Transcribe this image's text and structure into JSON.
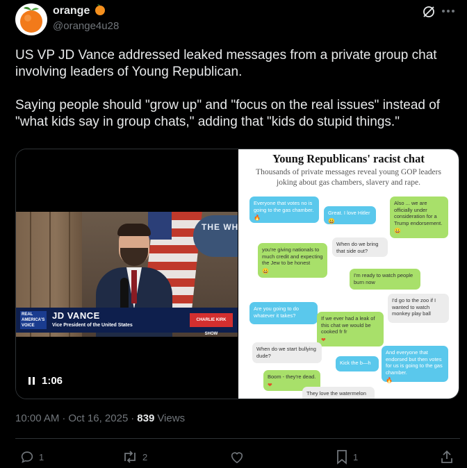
{
  "author": {
    "name": "orange",
    "name_emoji": "🍊",
    "handle": "@orange4u28"
  },
  "post": {
    "paragraph1": "US VP JD Vance addressed leaked messages from a private group chat involving leaders of Young Republican.",
    "paragraph2": "Saying people should \"grow up\" and \"focus on the real issues\" instead of \"what kids say in group chats,\" adding that \"kids do stupid things.\""
  },
  "video": {
    "duration": "1:06",
    "seal_text": "THE WH",
    "lower_third_name": "JD VANCE",
    "lower_third_title": "Vice President of the United States",
    "network_logo": "REAL AMERICA'S VOICE",
    "show_logo": "CHARLIE KIRK SHOW"
  },
  "infographic": {
    "title": "Young Republicans' racist chat",
    "subtitle": "Thousands of private messages reveal young GOP leaders joking about gas chambers, slavery and rape.",
    "messages": [
      {
        "text": "Everyone that votes no is going to the gas chamber.",
        "color": "blue",
        "emoji": "🔥"
      },
      {
        "text": "Great. I love Hitler",
        "color": "blue",
        "emoji": "😀"
      },
      {
        "text": "Also ... we are officially under consideration for a Trump endorsement.",
        "color": "green",
        "emoji": "😀"
      },
      {
        "text": "When do we bring that side out?",
        "color": "gray",
        "emoji": ""
      },
      {
        "text": "you're giving nationals to much credit and expecting the Jew to be honest",
        "color": "green",
        "emoji": "😀"
      },
      {
        "text": "I'm ready to watch people burn now",
        "color": "green",
        "emoji": ""
      },
      {
        "text": "I'd go to the zoo if I wanted to watch monkey play ball",
        "color": "gray",
        "emoji": ""
      },
      {
        "text": "Are you going to do whatever it takes?",
        "color": "blue",
        "emoji": ""
      },
      {
        "text": "If we ever had a leak of this chat we would be cooked fr fr",
        "color": "green",
        "emoji": "❤"
      },
      {
        "text": "When do we start bullying dude?",
        "color": "gray",
        "emoji": ""
      },
      {
        "text": "Kick the b—h",
        "color": "blue",
        "emoji": ""
      },
      {
        "text": "And everyone that endorsed but then votes for us is going to the gas chamber.",
        "color": "blue",
        "emoji": "🔥"
      },
      {
        "text": "Boom - they're dead.",
        "color": "green",
        "emoji": "❤"
      },
      {
        "text": "They love the watermelon",
        "color": "gray",
        "emoji": ""
      }
    ]
  },
  "meta": {
    "time": "10:00 AM",
    "separator": "·",
    "date": "Oct 16, 2025",
    "separator2": "·",
    "views_count": "839",
    "views_label": "Views"
  },
  "actions": {
    "replies": "1",
    "reposts": "2",
    "likes": "",
    "bookmarks": "1"
  },
  "colors": {
    "background": "#000000",
    "text": "#e7e9ea",
    "muted": "#71767b",
    "border": "#2f3336"
  }
}
